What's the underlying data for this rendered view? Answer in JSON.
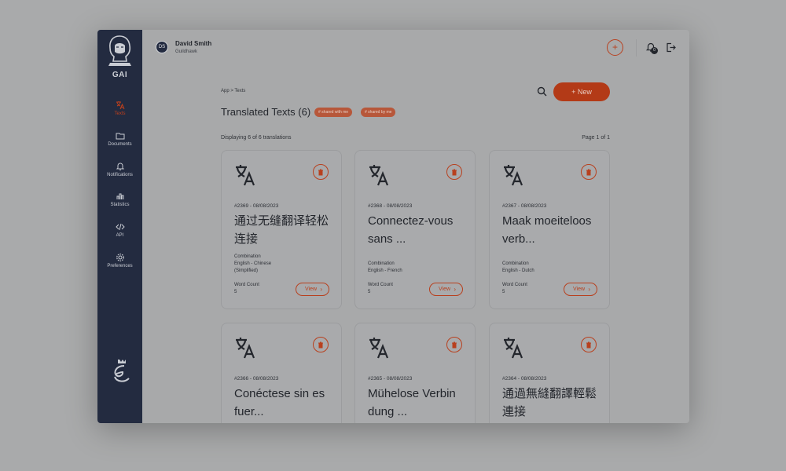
{
  "app": {
    "logo_text": "GAI"
  },
  "sidebar": {
    "items": [
      {
        "label": "Texts",
        "icon": "translate-icon",
        "active": true
      },
      {
        "label": "Documents",
        "icon": "folder-icon"
      },
      {
        "label": "Notifications",
        "icon": "bell-icon"
      },
      {
        "label": "Statistics",
        "icon": "bar-chart-icon"
      },
      {
        "label": "API",
        "icon": "code-icon"
      },
      {
        "label": "Preferences",
        "icon": "gear-icon"
      }
    ]
  },
  "header": {
    "avatar_initials": "DS",
    "user_name": "David Smith",
    "user_org": "Guildhawk",
    "notification_count": "0"
  },
  "content": {
    "breadcrumb": [
      "App",
      "Texts"
    ],
    "title": "Translated Texts (6)",
    "chips": [
      "# shared with me",
      "# shared by me"
    ],
    "new_button": "New",
    "displaying": "Displaying 6 of 6 translations",
    "pagination": "Page 1 of 1"
  },
  "cards": [
    {
      "meta": "#2369 - 08/08/2023",
      "title": "通过无缝翻译轻松连接",
      "combination_label": "Combination",
      "combination": "English - Chinese (Simplified)",
      "word_count_label": "Word Count",
      "word_count": "5",
      "view_label": "View"
    },
    {
      "meta": "#2368 - 08/08/2023",
      "title": "Connectez-vous sans ...",
      "combination_label": "Combination",
      "combination": "English - French",
      "word_count_label": "Word Count",
      "word_count": "5",
      "view_label": "View"
    },
    {
      "meta": "#2367 - 08/08/2023",
      "title": "Maak moeiteloos verb...",
      "combination_label": "Combination",
      "combination": "English - Dutch",
      "word_count_label": "Word Count",
      "word_count": "5",
      "view_label": "View"
    },
    {
      "meta": "#2366 - 08/08/2023",
      "title": "Conéctese sin es fuer...",
      "combination_label": "",
      "combination": "",
      "word_count_label": "",
      "word_count": "",
      "view_label": ""
    },
    {
      "meta": "#2365 - 08/08/2023",
      "title": "Mühelose Verbin dung ...",
      "combination_label": "",
      "combination": "",
      "word_count_label": "",
      "word_count": "",
      "view_label": ""
    },
    {
      "meta": "#2364 - 08/08/2023",
      "title": "通過無縫翻譯輕鬆連接",
      "combination_label": "",
      "combination": "",
      "word_count_label": "",
      "word_count": "",
      "view_label": ""
    }
  ],
  "colors": {
    "accent": "#b33a17",
    "sidebar_bg": "#232b40",
    "overlay_bg": "#a9aaab"
  }
}
